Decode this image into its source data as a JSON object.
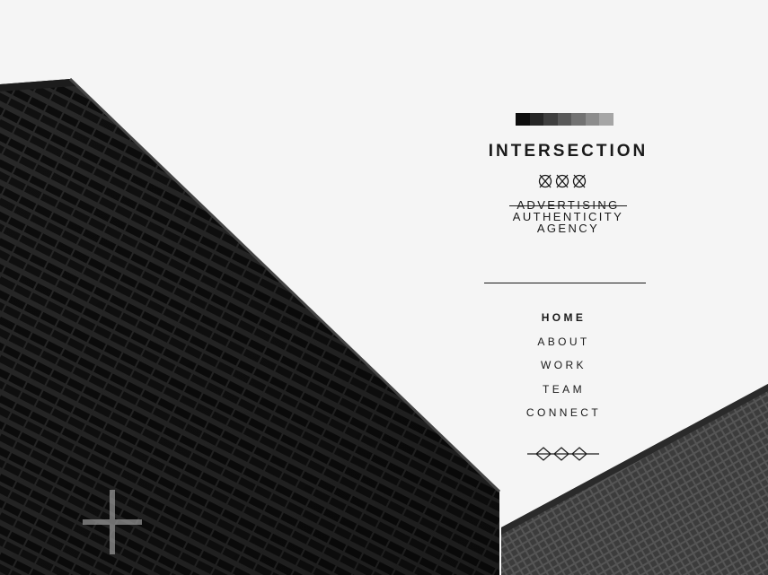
{
  "brand": {
    "swatch_colors": [
      "#0d0d0d",
      "#262626",
      "#3f3f3f",
      "#595959",
      "#727272",
      "#8c8c8c",
      "#a5a5a5"
    ],
    "title": "INTERSECTION",
    "mark_icon": "triple-crossed-circles-icon"
  },
  "tagline": {
    "struck": "ADVERTISING",
    "line2": "AUTHENTICITY",
    "line3": "AGENCY"
  },
  "nav": {
    "items": [
      {
        "label": "HOME",
        "active": true
      },
      {
        "label": "ABOUT",
        "active": false
      },
      {
        "label": "WORK",
        "active": false
      },
      {
        "label": "TEAM",
        "active": false
      },
      {
        "label": "CONNECT",
        "active": false
      }
    ]
  },
  "footer_ornament": "triple-diamond-icon",
  "decor": {
    "plus_icon": "plus-icon"
  },
  "colors": {
    "ink": "#1a1a1a",
    "background": "#f5f5f5"
  }
}
